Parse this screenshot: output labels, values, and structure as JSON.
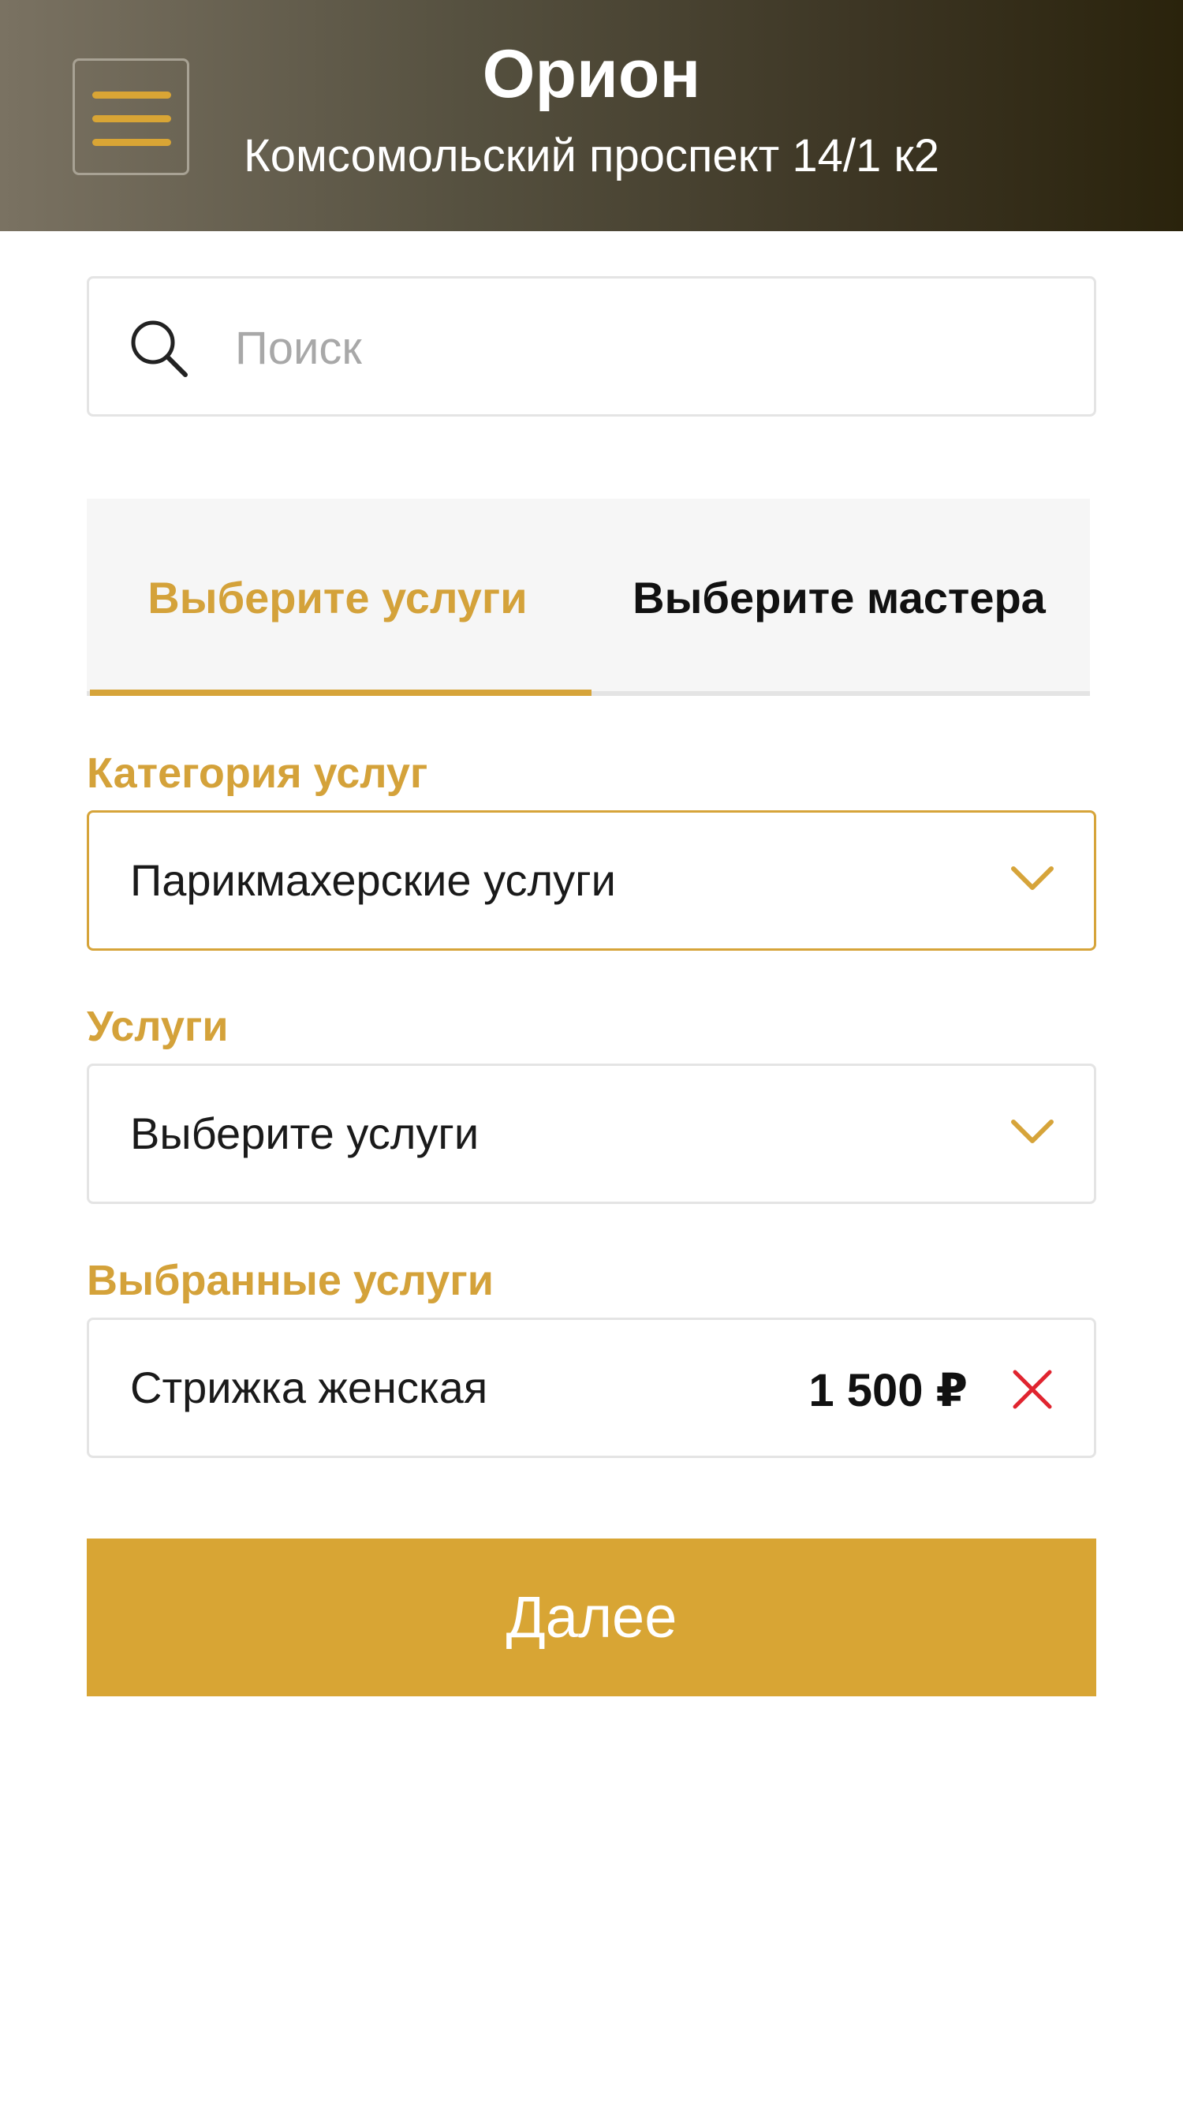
{
  "header": {
    "title": "Орион",
    "subtitle": "Комсомольский проспект 14/1 к2"
  },
  "icons": {
    "menu": "menu-icon",
    "search": "search-icon",
    "chevron": "chevron-down-icon",
    "remove": "close-icon"
  },
  "search": {
    "placeholder": "Поиск",
    "value": ""
  },
  "tabs": [
    {
      "label": "Выберите услуги",
      "active": true
    },
    {
      "label": "Выберите мастера",
      "active": false
    }
  ],
  "category": {
    "label": "Категория услуг",
    "value": "Парикмахерские услуги"
  },
  "services": {
    "label": "Услуги",
    "value": "Выберите услуги"
  },
  "selected": {
    "label": "Выбранные услуги",
    "items": [
      {
        "name": "Стрижка женская",
        "price": "1 500 ₽"
      }
    ]
  },
  "actions": {
    "next_label": "Далее"
  },
  "colors": {
    "accent": "#D8A534",
    "remove": "#E0242F",
    "header_start": "#7A7262",
    "header_end": "#2A230C"
  }
}
